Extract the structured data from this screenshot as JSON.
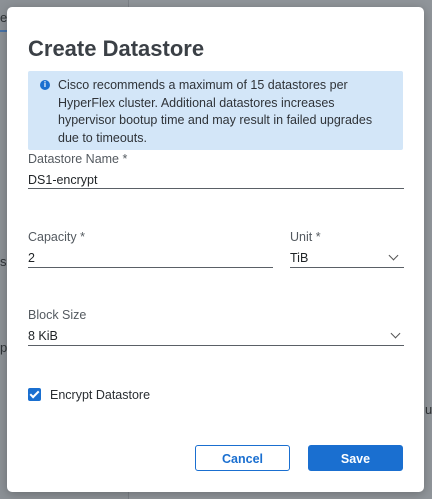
{
  "background": {
    "left_edge_chars": [
      "e",
      "s",
      "p"
    ],
    "right_edge_chars": [
      "u"
    ]
  },
  "modal": {
    "title": "Create Datastore",
    "banner": {
      "icon": "info-icon",
      "text": "Cisco recommends a maximum of 15 datastores per HyperFlex cluster. Additional datastores increases hypervisor bootup time and may result in failed upgrades due to timeouts."
    },
    "fields": {
      "name": {
        "label": "Datastore Name *",
        "value": "DS1-encrypt"
      },
      "capacity": {
        "label": "Capacity *",
        "value": "2"
      },
      "unit": {
        "label": "Unit *",
        "value": "TiB"
      },
      "block_size": {
        "label": "Block Size",
        "value": "8 KiB"
      }
    },
    "encrypt": {
      "label": "Encrypt Datastore",
      "checked": true
    },
    "buttons": {
      "cancel": "Cancel",
      "save": "Save"
    }
  },
  "colors": {
    "accent": "#1a6fd0",
    "banner_bg": "#d3e6f8"
  }
}
